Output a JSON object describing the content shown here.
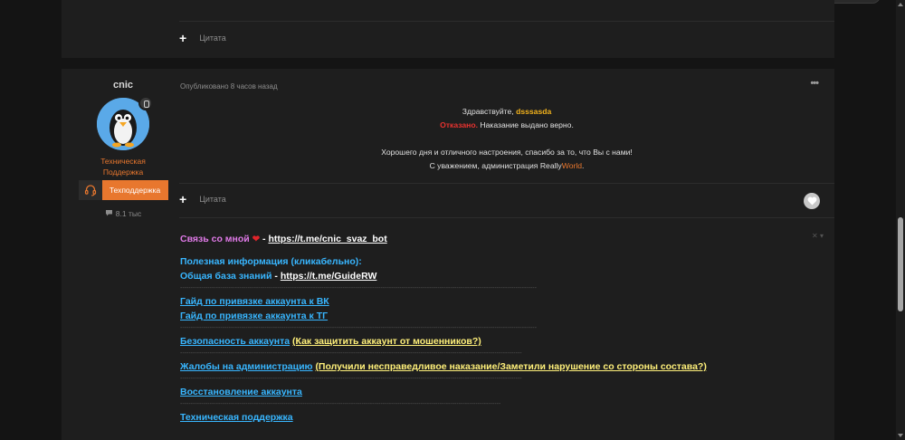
{
  "prev_post": {
    "quote_label": "Цитата"
  },
  "author": {
    "name": "cnic",
    "role_line1": "Техническая",
    "role_line2": "Поддержка",
    "badge_label": "Техподдержка",
    "reputation": "8.1 тыс"
  },
  "post": {
    "published": "Опубликовано 8 часов назад",
    "more_menu": "•••",
    "greeting_prefix": "Здравствуйте,",
    "greeting_name": "dsssasda",
    "denied": "Отказано.",
    "denied_text": "Наказание выдано верно.",
    "wish_line": "Хорошего дня и отличного настроения, спасибо за то, что Вы с нами!",
    "regards_prefix": "С уважением, администрация Really",
    "regards_brand": "World",
    "regards_end": ".",
    "quote_label": "Цитата"
  },
  "signature": {
    "contact_label": "Связь со мной",
    "contact_sep": " - ",
    "contact_link": "https://t.me/cnic_svaz_bot",
    "useful_info": "Полезная информация (кликабельно):",
    "kb_label": "Общая база знаний",
    "kb_sep": " - ",
    "kb_link": "https://t.me/GuideRW",
    "guide_vk": "Гайд по привязке аккаунта к ВК",
    "guide_tg": "Гайд по привязке аккаунта к ТГ",
    "security_label": "Безопасность аккаунта",
    "security_note": "(Как защитить аккаунт от мошенников?)",
    "complaints_label": "Жалобы на администрацию",
    "complaints_note": "(Получили несправедливое наказание/Заметили нарушение со стороны состава?)",
    "recovery": "Восстановление аккаунта",
    "tech_support": "Техническая поддержка",
    "close_label": "✕ ▾"
  },
  "colors": {
    "accent_orange": "#e8772e",
    "greeting_yellow": "#f2b21c",
    "denied_red": "#e8322f",
    "link_blue": "#38b6ff",
    "note_yellow": "#fff07a",
    "contact_pink": "#e07ae8"
  },
  "icons": {
    "plus": "plus-icon",
    "more": "more-options-icon",
    "like": "heart-icon",
    "headset": "headset-icon",
    "comment": "comment-icon"
  }
}
